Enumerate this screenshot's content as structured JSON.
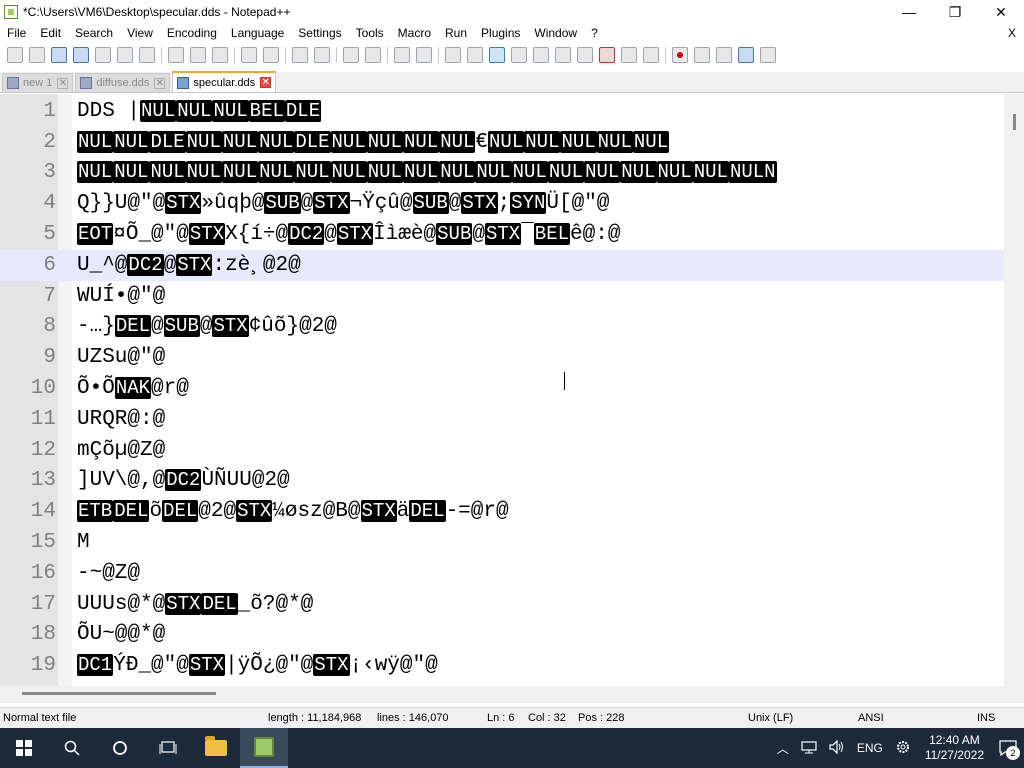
{
  "window": {
    "title": "*C:\\Users\\VM6\\Desktop\\specular.dds - Notepad++",
    "controls": {
      "minimize": "—",
      "maximize": "❐",
      "close": "✕"
    }
  },
  "menubar": {
    "items": [
      "File",
      "Edit",
      "Search",
      "View",
      "Encoding",
      "Language",
      "Settings",
      "Tools",
      "Macro",
      "Run",
      "Plugins",
      "Window",
      "?"
    ],
    "close_doc": "X"
  },
  "tabs": [
    {
      "label": "new 1",
      "active": false
    },
    {
      "label": "diffuse.dds",
      "active": false
    },
    {
      "label": "specular.dds",
      "active": true
    }
  ],
  "editor": {
    "current_line": 6,
    "lines": [
      {
        "num": "1",
        "segments": [
          [
            "t",
            "DDS |"
          ],
          [
            "c",
            "NUL"
          ],
          [
            "c",
            "NUL"
          ],
          [
            "c",
            "NUL"
          ],
          [
            "c",
            "BEL"
          ],
          [
            "c",
            "DLE"
          ]
        ]
      },
      {
        "num": "2",
        "segments": [
          [
            "c",
            "NUL"
          ],
          [
            "c",
            "NUL"
          ],
          [
            "c",
            "DLE"
          ],
          [
            "c",
            "NUL"
          ],
          [
            "c",
            "NUL"
          ],
          [
            "c",
            "NUL"
          ],
          [
            "c",
            "DLE"
          ],
          [
            "c",
            "NUL"
          ],
          [
            "c",
            "NUL"
          ],
          [
            "c",
            "NUL"
          ],
          [
            "c",
            "NUL"
          ],
          [
            "t",
            "€"
          ],
          [
            "c",
            "NUL"
          ],
          [
            "c",
            "NUL"
          ],
          [
            "c",
            "NUL"
          ],
          [
            "c",
            "NUL"
          ],
          [
            "c",
            "NUL"
          ]
        ]
      },
      {
        "num": "3",
        "segments": [
          [
            "c",
            "NUL"
          ],
          [
            "c",
            "NUL"
          ],
          [
            "c",
            "NUL"
          ],
          [
            "c",
            "NUL"
          ],
          [
            "c",
            "NUL"
          ],
          [
            "c",
            "NUL"
          ],
          [
            "c",
            "NUL"
          ],
          [
            "c",
            "NUL"
          ],
          [
            "c",
            "NUL"
          ],
          [
            "c",
            "NUL"
          ],
          [
            "c",
            "NUL"
          ],
          [
            "c",
            "NUL"
          ],
          [
            "c",
            "NUL"
          ],
          [
            "c",
            "NUL"
          ],
          [
            "c",
            "NUL"
          ],
          [
            "c",
            "NUL"
          ],
          [
            "c",
            "NUL"
          ],
          [
            "c",
            "NUL"
          ],
          [
            "c",
            "NULN"
          ]
        ]
      },
      {
        "num": "4",
        "segments": [
          [
            "t",
            "Q}}U@\"@"
          ],
          [
            "c",
            "STX"
          ],
          [
            "t",
            "»ûqþ@"
          ],
          [
            "c",
            "SUB"
          ],
          [
            "t",
            "@"
          ],
          [
            "c",
            "STX"
          ],
          [
            "t",
            "¬Ÿçû@"
          ],
          [
            "c",
            "SUB"
          ],
          [
            "t",
            "@"
          ],
          [
            "c",
            "STX"
          ],
          [
            "t",
            ";"
          ],
          [
            "c",
            "SYN"
          ],
          [
            "t",
            "Ü[@\"@"
          ]
        ]
      },
      {
        "num": "5",
        "segments": [
          [
            "c",
            "EOT"
          ],
          [
            "t",
            "¤Õ_@\"@"
          ],
          [
            "c",
            "STX"
          ],
          [
            "t",
            "X{í÷@"
          ],
          [
            "c",
            "DC2"
          ],
          [
            "t",
            "@"
          ],
          [
            "c",
            "STX"
          ],
          [
            "t",
            "Îìæè@"
          ],
          [
            "c",
            "SUB"
          ],
          [
            "t",
            "@"
          ],
          [
            "c",
            "STX"
          ],
          [
            "t",
            "¯"
          ],
          [
            "c",
            "BEL"
          ],
          [
            "t",
            "ê@:@"
          ]
        ]
      },
      {
        "num": "6",
        "segments": [
          [
            "t",
            "U_^@"
          ],
          [
            "c",
            "DC2"
          ],
          [
            "t",
            "@"
          ],
          [
            "c",
            "STX"
          ],
          [
            "t",
            ":zè¸@2@"
          ]
        ]
      },
      {
        "num": "7",
        "segments": [
          [
            "t",
            "WUÍ•@\"@"
          ]
        ]
      },
      {
        "num": "8",
        "segments": [
          [
            "t",
            "-…}"
          ],
          [
            "c",
            "DEL"
          ],
          [
            "t",
            "@"
          ],
          [
            "c",
            "SUB"
          ],
          [
            "t",
            "@"
          ],
          [
            "c",
            "STX"
          ],
          [
            "t",
            "¢ûõ}@2@"
          ]
        ]
      },
      {
        "num": "9",
        "segments": [
          [
            "t",
            "UZSu@\"@"
          ]
        ]
      },
      {
        "num": "10",
        "segments": [
          [
            "t",
            "Õ•Õ"
          ],
          [
            "c",
            "NAK"
          ],
          [
            "t",
            "@r@"
          ]
        ]
      },
      {
        "num": "11",
        "segments": [
          [
            "t",
            "URQR@:@"
          ]
        ]
      },
      {
        "num": "12",
        "segments": [
          [
            "t",
            "mÇõµ@Z@"
          ]
        ]
      },
      {
        "num": "13",
        "segments": [
          [
            "t",
            "]UV\\@,@"
          ],
          [
            "c",
            "DC2"
          ],
          [
            "t",
            "ÙÑUU@2@"
          ]
        ]
      },
      {
        "num": "14",
        "segments": [
          [
            "c",
            "ETB"
          ],
          [
            "c",
            "DEL"
          ],
          [
            "t",
            "õ"
          ],
          [
            "c",
            "DEL"
          ],
          [
            "t",
            "@2@"
          ],
          [
            "c",
            "STX"
          ],
          [
            "t",
            "¼øsz@B@"
          ],
          [
            "c",
            "STX"
          ],
          [
            "t",
            "ä"
          ],
          [
            "c",
            "DEL"
          ],
          [
            "t",
            "-=@r@"
          ]
        ]
      },
      {
        "num": "15",
        "segments": [
          [
            "t",
            "M"
          ]
        ]
      },
      {
        "num": "16",
        "segments": [
          [
            "t",
            "-~@Z@"
          ]
        ]
      },
      {
        "num": "17",
        "segments": [
          [
            "t",
            "UUUs@*@"
          ],
          [
            "c",
            "STX"
          ],
          [
            "c",
            "DEL"
          ],
          [
            "t",
            "_õ?@*@"
          ]
        ]
      },
      {
        "num": "18",
        "segments": [
          [
            "t",
            "ÕU~@@*@"
          ]
        ]
      },
      {
        "num": "19",
        "segments": [
          [
            "c",
            "DC1"
          ],
          [
            "t",
            "ÝÐ_@\"@"
          ],
          [
            "c",
            "STX"
          ],
          [
            "t",
            "|ÿÕ¿@\"@"
          ],
          [
            "c",
            "STX"
          ],
          [
            "t",
            "¡‹wÿ@\"@"
          ]
        ]
      }
    ]
  },
  "statusbar": {
    "type": "Normal text file",
    "length": "length : 11,184,968",
    "lines": "lines : 146,070",
    "ln": "Ln : 6",
    "col": "Col : 32",
    "pos": "Pos : 228",
    "eol": "Unix (LF)",
    "encoding": "ANSI",
    "mode": "INS"
  },
  "taskbar": {
    "tray": {
      "language": "ENG",
      "time": "12:40 AM",
      "date": "11/27/2022",
      "notifications": "2"
    }
  },
  "colors": {
    "accent_tab": "#f5a623",
    "control_char_bg": "#000000",
    "current_line": "#e8e8ff",
    "taskbar": "#1c2a3a"
  }
}
